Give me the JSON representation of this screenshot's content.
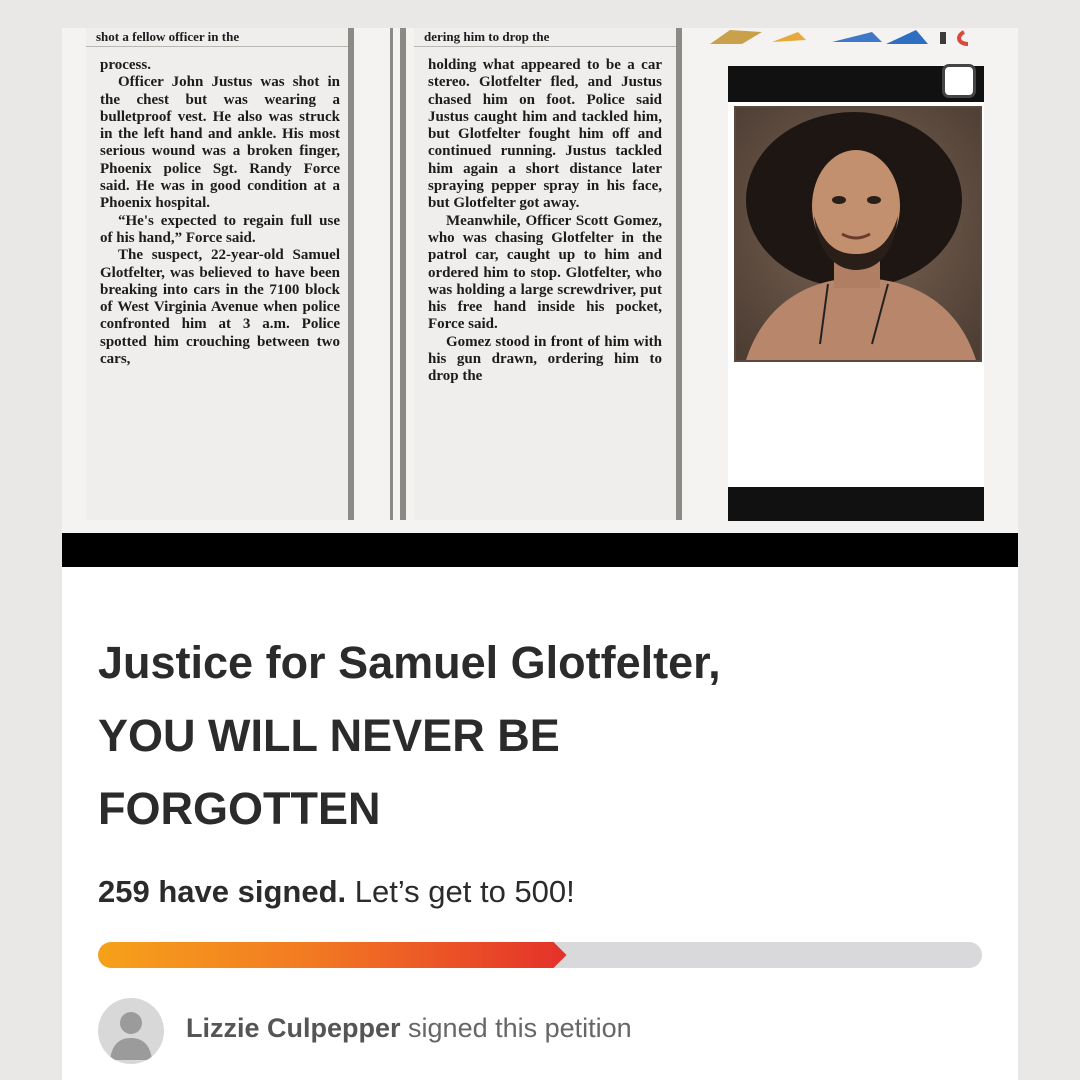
{
  "clipping": {
    "col1_cut_line": "shot a fellow officer in the",
    "col1_paragraphs": [
      "process.",
      "Officer John Justus was shot in the chest but was wearing a bulletproof vest. He also was struck in the left hand and ankle. His most serious wound was a broken finger, Phoenix police Sgt. Randy Force said. He was in good condition at a Phoenix hospital.",
      "“He's expected to regain full use of his hand,” Force said.",
      "The suspect, 22-year-old Samuel Glotfelter, was believed to have been breaking into cars in the 7100 block of West Virginia Avenue when police confronted him at 3 a.m. Police spotted him crouching between two cars,"
    ],
    "col2_cut_line": "dering him to drop the",
    "col2_paragraphs": [
      "holding what appeared to be a car stereo. Glotfelter fled, and Justus chased him on foot. Police said Justus caught him and tackled him, but Glotfelter fought him off and continued running. Justus tackled him again a short distance later spraying pepper spray in his face, but Glotfelter got away.",
      "Meanwhile, Officer Scott Gomez, who was chasing Glotfelter in the patrol car, caught up to him and ordered him to stop. Glotfelter, who was holding a large screwdriver, put his free hand inside his pocket, Force said.",
      "Gomez stood in front of him with his gun drawn, ordering him to drop the"
    ]
  },
  "petition": {
    "title_lines": [
      "Justice for Samuel Glotfelter,",
      "YOU WILL NEVER BE",
      "FORGOTTEN"
    ],
    "signed_count_text": "259 have signed.",
    "goal_text": " Let’s get to 500!",
    "signed": 259,
    "goal": 500,
    "progress_fraction": 0.53
  },
  "recent_signer": {
    "name": "Lizzie Culpepper",
    "action": " signed this petition"
  },
  "colors": {
    "progress_start": "#f6a11a",
    "progress_end": "#e4312a",
    "track": "#d9d8db",
    "title_text": "#2b2b2b"
  }
}
